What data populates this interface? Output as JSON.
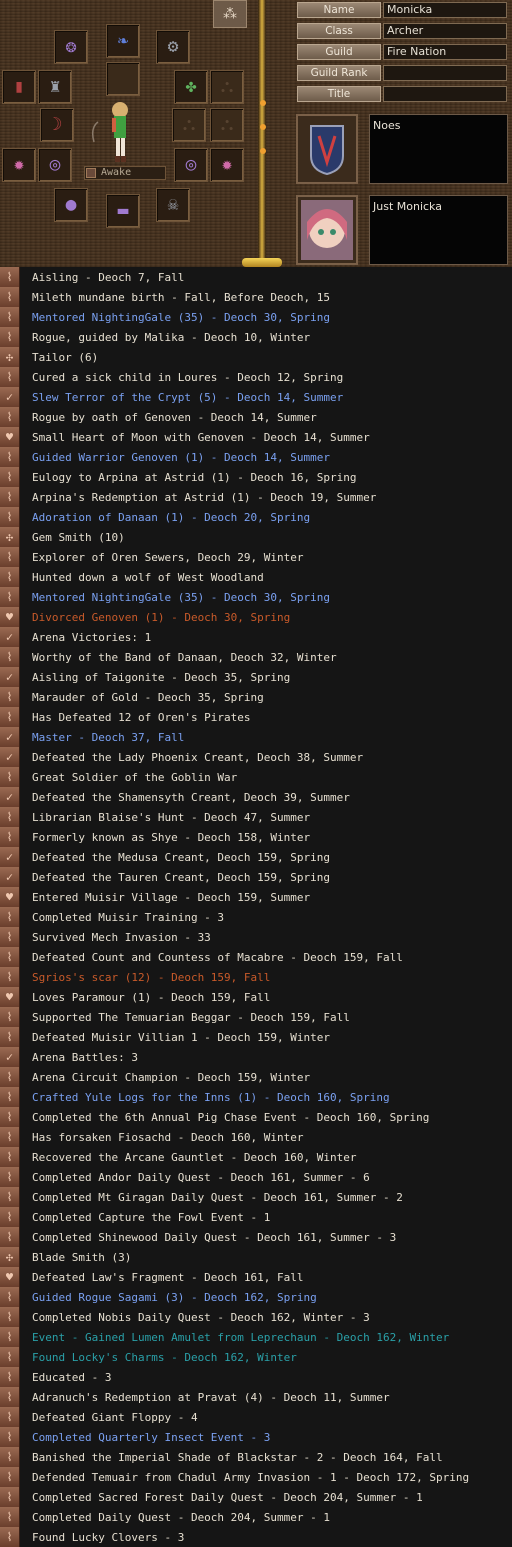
{
  "profile": {
    "fields": [
      {
        "label": "Name",
        "value": "Monicka"
      },
      {
        "label": "Class",
        "value": "Archer"
      },
      {
        "label": "Guild",
        "value": "Fire Nation"
      },
      {
        "label": "Guild Rank",
        "value": ""
      },
      {
        "label": "Title",
        "value": ""
      }
    ],
    "status_label": "Awake",
    "emblem_text": "Noes",
    "portrait_text": "Just Monicka"
  },
  "legend": [
    {
      "icon": "scroll-icon",
      "text": "Aisling - Deoch 7, Fall",
      "color": "default"
    },
    {
      "icon": "scroll-icon",
      "text": "Mileth mundane birth - Fall, Before Deoch, 15",
      "color": "default"
    },
    {
      "icon": "scroll-icon",
      "text": "Mentored NightingGale (35) - Deoch 30, Spring",
      "color": "blue"
    },
    {
      "icon": "scroll-icon",
      "text": "Rogue, guided by Malika - Deoch 10, Winter",
      "color": "default"
    },
    {
      "icon": "hammer-icon",
      "text": "Tailor (6)",
      "color": "default"
    },
    {
      "icon": "scroll-icon",
      "text": "Cured a sick child in Loures - Deoch 12, Spring",
      "color": "default"
    },
    {
      "icon": "check-icon",
      "text": "Slew Terror of the Crypt (5) - Deoch 14, Summer",
      "color": "blue"
    },
    {
      "icon": "scroll-icon",
      "text": "Rogue by oath of Genoven - Deoch 14, Summer",
      "color": "default"
    },
    {
      "icon": "heart-icon",
      "text": "Small Heart of Moon with Genoven - Deoch 14, Summer",
      "color": "default"
    },
    {
      "icon": "scroll-icon",
      "text": "Guided Warrior Genoven (1) - Deoch 14, Summer",
      "color": "blue"
    },
    {
      "icon": "scroll-icon",
      "text": "Eulogy to Arpina at Astrid (1) - Deoch 16, Spring",
      "color": "default"
    },
    {
      "icon": "scroll-icon",
      "text": "Arpina's Redemption at Astrid (1) - Deoch 19, Summer",
      "color": "default"
    },
    {
      "icon": "scroll-icon",
      "text": "Adoration of Danaan (1) - Deoch 20, Spring",
      "color": "blue"
    },
    {
      "icon": "hammer-icon",
      "text": "Gem Smith (10)",
      "color": "default"
    },
    {
      "icon": "scroll-icon",
      "text": "Explorer of Oren Sewers, Deoch 29, Winter",
      "color": "default"
    },
    {
      "icon": "scroll-icon",
      "text": "Hunted down a wolf of West Woodland",
      "color": "default"
    },
    {
      "icon": "scroll-icon",
      "text": "Mentored NightingGale (35) - Deoch 30, Spring",
      "color": "blue"
    },
    {
      "icon": "heart-icon",
      "text": "Divorced Genoven (1) - Deoch 30, Spring",
      "color": "orange"
    },
    {
      "icon": "check-icon",
      "text": "Arena Victories: 1",
      "color": "default"
    },
    {
      "icon": "scroll-icon",
      "text": "Worthy of the Band of Danaan, Deoch 32, Winter",
      "color": "default"
    },
    {
      "icon": "check-icon",
      "text": "Aisling of Taigonite - Deoch 35, Spring",
      "color": "default"
    },
    {
      "icon": "scroll-icon",
      "text": "Marauder of Gold - Deoch 35, Spring",
      "color": "default"
    },
    {
      "icon": "scroll-icon",
      "text": "Has Defeated 12 of Oren's Pirates",
      "color": "default"
    },
    {
      "icon": "check-icon",
      "text": "Master - Deoch 37, Fall",
      "color": "blue"
    },
    {
      "icon": "check-icon",
      "text": "Defeated the Lady Phoenix Creant, Deoch 38, Summer",
      "color": "default"
    },
    {
      "icon": "scroll-icon",
      "text": "Great Soldier of the Goblin War",
      "color": "default"
    },
    {
      "icon": "check-icon",
      "text": "Defeated the Shamensyth Creant, Deoch 39, Summer",
      "color": "default"
    },
    {
      "icon": "scroll-icon",
      "text": "Librarian Blaise's Hunt - Deoch 47, Summer",
      "color": "default"
    },
    {
      "icon": "scroll-icon",
      "text": "Formerly known as Shye - Deoch 158, Winter",
      "color": "default"
    },
    {
      "icon": "check-icon",
      "text": "Defeated the Medusa Creant, Deoch 159, Spring",
      "color": "default"
    },
    {
      "icon": "check-icon",
      "text": "Defeated the Tauren Creant, Deoch 159, Spring",
      "color": "default"
    },
    {
      "icon": "heart-icon",
      "text": "Entered Muisir Village - Deoch 159, Summer",
      "color": "default"
    },
    {
      "icon": "scroll-icon",
      "text": "Completed Muisir Training - 3",
      "color": "default"
    },
    {
      "icon": "scroll-icon",
      "text": "Survived Mech Invasion - 33",
      "color": "default"
    },
    {
      "icon": "scroll-icon",
      "text": "Defeated Count and Countess of Macabre - Deoch 159, Fall",
      "color": "default"
    },
    {
      "icon": "scroll-icon",
      "text": "Sgrios's scar (12) - Deoch 159, Fall",
      "color": "orange"
    },
    {
      "icon": "heart-icon",
      "text": "Loves Paramour (1) - Deoch 159, Fall",
      "color": "default"
    },
    {
      "icon": "scroll-icon",
      "text": "Supported The Temuarian Beggar - Deoch 159, Fall",
      "color": "default"
    },
    {
      "icon": "scroll-icon",
      "text": "Defeated Muisir Villian 1 - Deoch 159, Winter",
      "color": "default"
    },
    {
      "icon": "check-icon",
      "text": "Arena Battles: 3",
      "color": "default"
    },
    {
      "icon": "scroll-icon",
      "text": "Arena Circuit Champion - Deoch 159, Winter",
      "color": "default"
    },
    {
      "icon": "scroll-icon",
      "text": "Crafted Yule Logs for the Inns (1) - Deoch 160, Spring",
      "color": "blue"
    },
    {
      "icon": "scroll-icon",
      "text": "Completed the 6th Annual Pig Chase Event - Deoch 160, Spring",
      "color": "default"
    },
    {
      "icon": "scroll-icon",
      "text": "Has forsaken Fiosachd - Deoch 160, Winter",
      "color": "default"
    },
    {
      "icon": "scroll-icon",
      "text": "Recovered the Arcane Gauntlet - Deoch 160, Winter",
      "color": "default"
    },
    {
      "icon": "scroll-icon",
      "text": "Completed Andor Daily Quest - Deoch 161, Summer - 6",
      "color": "default"
    },
    {
      "icon": "scroll-icon",
      "text": "Completed Mt Giragan Daily Quest - Deoch 161, Summer - 2",
      "color": "default"
    },
    {
      "icon": "scroll-icon",
      "text": "Completed Capture the Fowl Event - 1",
      "color": "default"
    },
    {
      "icon": "scroll-icon",
      "text": "Completed Shinewood Daily Quest - Deoch 161, Summer - 3",
      "color": "default"
    },
    {
      "icon": "hammer-icon",
      "text": "Blade Smith (3)",
      "color": "default"
    },
    {
      "icon": "heart-icon",
      "text": "Defeated Law's Fragment - Deoch 161, Fall",
      "color": "default"
    },
    {
      "icon": "scroll-icon",
      "text": "Guided Rogue Sagami (3) - Deoch 162, Spring",
      "color": "blue"
    },
    {
      "icon": "scroll-icon",
      "text": "Completed Nobis Daily Quest - Deoch 162, Winter - 3",
      "color": "default"
    },
    {
      "icon": "scroll-icon",
      "text": "Event - Gained Lumen Amulet from Leprechaun - Deoch 162, Winter",
      "color": "teal"
    },
    {
      "icon": "scroll-icon",
      "text": "Found Locky's Charms - Deoch 162, Winter",
      "color": "teal"
    },
    {
      "icon": "scroll-icon",
      "text": "Educated - 3",
      "color": "default"
    },
    {
      "icon": "scroll-icon",
      "text": "Adranuch's Redemption at Pravat (4) - Deoch 11, Summer",
      "color": "default"
    },
    {
      "icon": "scroll-icon",
      "text": "Defeated Giant Floppy - 4",
      "color": "default"
    },
    {
      "icon": "scroll-icon",
      "text": "Completed Quarterly Insect Event - 3",
      "color": "blue"
    },
    {
      "icon": "scroll-icon",
      "text": "Banished the Imperial Shade of Blackstar - 2 - Deoch 164, Fall",
      "color": "default"
    },
    {
      "icon": "scroll-icon",
      "text": "Defended Temuair from Chadul Army Invasion - 1 - Deoch 172, Spring",
      "color": "default"
    },
    {
      "icon": "scroll-icon",
      "text": "Completed Sacred Forest Daily Quest - Deoch 204, Summer - 1",
      "color": "default"
    },
    {
      "icon": "scroll-icon",
      "text": "Completed Daily Quest - Deoch 204, Summer - 1",
      "color": "default"
    },
    {
      "icon": "scroll-icon",
      "text": "Found Lucky Clovers - 3",
      "color": "default"
    }
  ],
  "colors": {
    "default": "#e6dfd0",
    "blue": "#7aa0f0",
    "orange": "#c85a2a",
    "teal": "#2aa0a8"
  }
}
